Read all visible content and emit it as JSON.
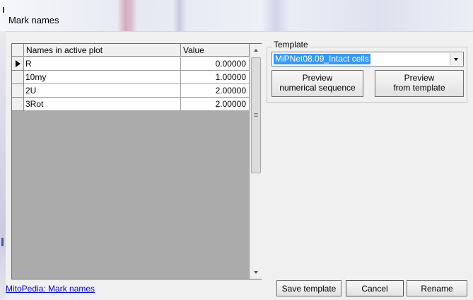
{
  "window": {
    "title": "Mark names"
  },
  "grid": {
    "headers": {
      "name": "Names in active plot",
      "value": "Value"
    },
    "rows": [
      {
        "name": "R",
        "value": "0.00000"
      },
      {
        "name": "10my",
        "value": "1.00000"
      },
      {
        "name": "2U",
        "value": "2.00000"
      },
      {
        "name": "3Rot",
        "value": "2.00000"
      }
    ]
  },
  "template": {
    "group_label": "Template",
    "selected": "MiPNet08.09_Intact cells",
    "preview_numerical_line1": "Preview",
    "preview_numerical_line2": "numerical sequence",
    "preview_template_line1": "Preview",
    "preview_template_line2": "from template"
  },
  "footer": {
    "help_link": "MitoPedia: Mark names",
    "save_template": "Save template",
    "cancel": "Cancel",
    "rename": "Rename"
  },
  "colors": {
    "selection": "#3399ff",
    "link": "#0000ee"
  }
}
